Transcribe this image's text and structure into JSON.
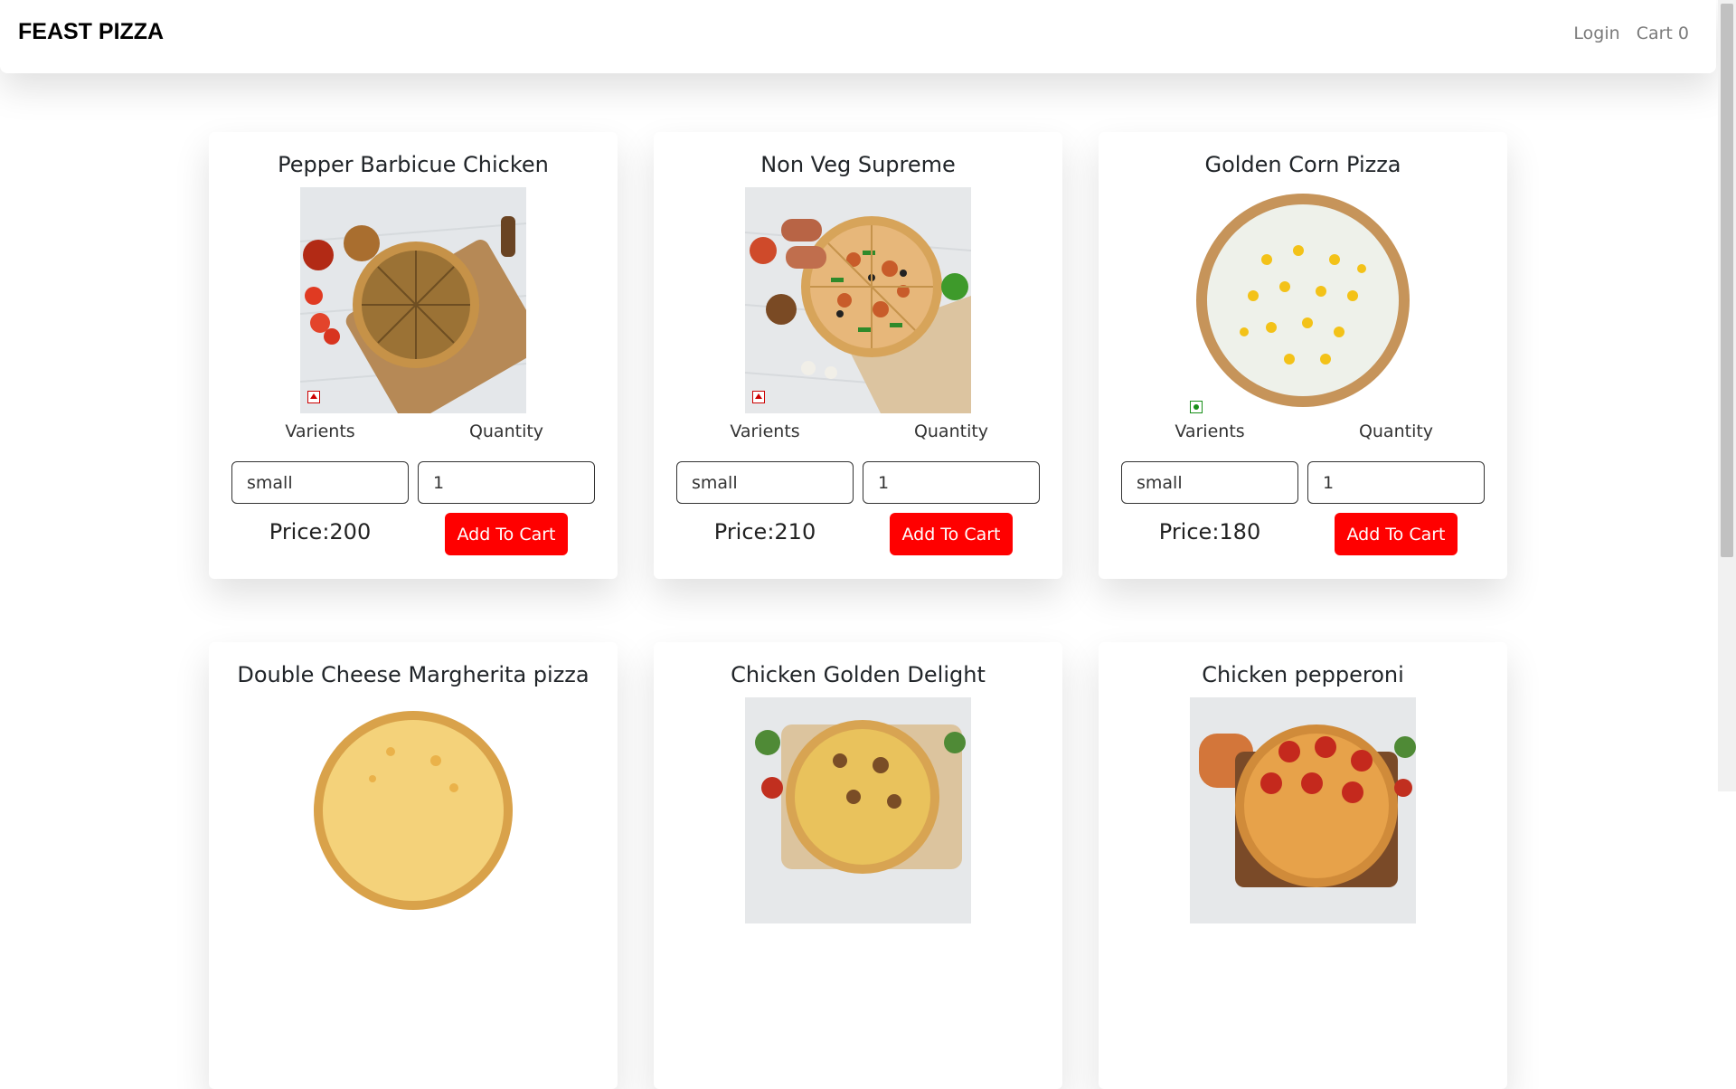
{
  "header": {
    "brand": "FEAST PIZZA",
    "login_label": "Login",
    "cart_label": "Cart 0"
  },
  "labels": {
    "varients": "Varients",
    "quantity": "Quantity",
    "add_to_cart": "Add To Cart"
  },
  "pizzas": [
    {
      "name": "Pepper Barbicue Chicken",
      "varient": "small",
      "quantity": "1",
      "price": "Price:200"
    },
    {
      "name": "Non Veg Supreme",
      "varient": "small",
      "quantity": "1",
      "price": "Price:210"
    },
    {
      "name": "Golden Corn Pizza",
      "varient": "small",
      "quantity": "1",
      "price": "Price:180"
    },
    {
      "name": "Double Cheese Margherita pizza"
    },
    {
      "name": "Chicken Golden Delight"
    },
    {
      "name": "Chicken pepperoni"
    }
  ],
  "colors": {
    "accent": "#ff0000",
    "nonveg_mark": "#cc0000",
    "veg_mark": "#188f18"
  }
}
